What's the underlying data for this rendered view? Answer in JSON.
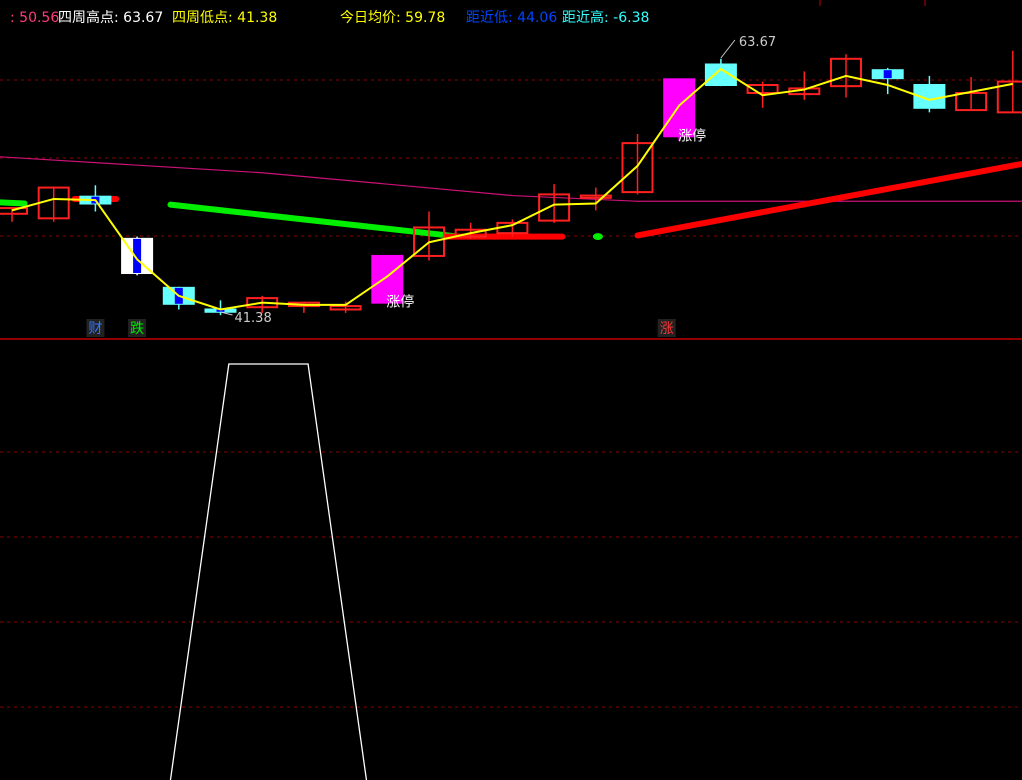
{
  "header": {
    "items": [
      {
        "label": "",
        "value": "50.56",
        "label_color": "#ff3b7b",
        "value_color": "#ff3b7b"
      },
      {
        "label": "四周高点",
        "value": "63.67",
        "label_color": "#ffffff",
        "value_color": "#ffffff"
      },
      {
        "label": "四周低点",
        "value": "41.38",
        "label_color": "#ffff00",
        "value_color": "#ffff00"
      },
      {
        "label": "今日均价",
        "value": "59.78",
        "label_color": "#ffff00",
        "value_color": "#ffff00"
      },
      {
        "label": "距近低",
        "value": "44.06",
        "label_color": "#0044ff",
        "value_color": "#0044ff"
      },
      {
        "label": "距近高",
        "value": "-6.38",
        "label_color": "#33ffff",
        "value_color": "#33ffff"
      }
    ]
  },
  "colors": {
    "background": "#000000",
    "up_candle": "#ff2020",
    "down_candle_body": "#66ffff",
    "down_candle_alt": "#0000ff",
    "limit_up": "#ff00ff",
    "avg_line": "#ffff00",
    "long_ma": "#cc1177",
    "trend_up": "#ff0000",
    "trend_down": "#00ee00",
    "grid": "#8b0000",
    "separator": "#c00000",
    "indicator": "#ffffff"
  },
  "chart_data": [
    {
      "type": "candlestick",
      "y_range": [
        40.5,
        66.0
      ],
      "candles": [
        {
          "o": 50.0,
          "h": 50.6,
          "l": 49.3,
          "c": 50.5,
          "style": "up"
        },
        {
          "o": 49.6,
          "h": 52.4,
          "l": 49.3,
          "c": 52.3,
          "style": "up"
        },
        {
          "o": 51.5,
          "h": 52.5,
          "l": 50.2,
          "c": 50.9,
          "style": "down"
        },
        {
          "o": 47.8,
          "h": 48.0,
          "l": 44.6,
          "c": 44.8,
          "style": "white-blue"
        },
        {
          "o": 43.5,
          "h": 43.6,
          "l": 41.6,
          "c": 42.1,
          "style": "down"
        },
        {
          "o": 41.6,
          "h": 42.4,
          "l": 41.1,
          "c": 41.4,
          "style": "down"
        },
        {
          "o": 41.8,
          "h": 42.8,
          "l": 41.3,
          "c": 42.6,
          "style": "up"
        },
        {
          "o": 41.9,
          "h": 42.3,
          "l": 41.3,
          "c": 42.2,
          "style": "up"
        },
        {
          "o": 41.6,
          "h": 42.3,
          "l": 41.3,
          "c": 41.9,
          "style": "up"
        },
        {
          "o": 42.2,
          "h": 46.3,
          "l": 42.2,
          "c": 46.3,
          "style": "limit",
          "label": "涨停"
        },
        {
          "o": 46.3,
          "h": 50.2,
          "l": 45.9,
          "c": 48.8,
          "style": "up"
        },
        {
          "o": 48.0,
          "h": 49.2,
          "l": 47.8,
          "c": 48.6,
          "style": "up"
        },
        {
          "o": 48.3,
          "h": 49.5,
          "l": 48.0,
          "c": 49.2,
          "style": "up"
        },
        {
          "o": 49.4,
          "h": 52.6,
          "l": 49.2,
          "c": 51.7,
          "style": "up"
        },
        {
          "o": 51.4,
          "h": 52.3,
          "l": 50.3,
          "c": 51.6,
          "style": "up"
        },
        {
          "o": 51.9,
          "h": 57.0,
          "l": 51.7,
          "c": 56.2,
          "style": "up"
        },
        {
          "o": 56.8,
          "h": 61.8,
          "l": 56.4,
          "c": 61.8,
          "style": "limit",
          "label": "涨停"
        },
        {
          "o": 63.1,
          "h": 63.6,
          "l": 61.2,
          "c": 61.3,
          "style": "down"
        },
        {
          "o": 60.6,
          "h": 61.6,
          "l": 59.3,
          "c": 61.3,
          "style": "up"
        },
        {
          "o": 60.5,
          "h": 62.5,
          "l": 60.0,
          "c": 61.0,
          "style": "up"
        },
        {
          "o": 61.2,
          "h": 64.0,
          "l": 60.2,
          "c": 63.6,
          "style": "up"
        },
        {
          "o": 62.6,
          "h": 62.8,
          "l": 60.5,
          "c": 61.9,
          "style": "down-blue"
        },
        {
          "o": 61.3,
          "h": 62.1,
          "l": 58.9,
          "c": 59.3,
          "style": "down"
        },
        {
          "o": 59.1,
          "h": 62.0,
          "l": 59.1,
          "c": 60.6,
          "style": "up"
        },
        {
          "o": 58.9,
          "h": 64.3,
          "l": 58.9,
          "c": 61.6,
          "style": "up"
        }
      ],
      "avg_line": [
        50.3,
        51.3,
        51.2,
        46.0,
        42.8,
        41.6,
        42.2,
        42.0,
        42.0,
        44.5,
        47.5,
        48.3,
        49.0,
        50.8,
        50.9,
        54.2,
        59.5,
        62.7,
        60.4,
        60.9,
        62.1,
        61.3,
        60.0,
        60.7,
        61.4
      ],
      "trend_band": [
        {
          "x_start": -0.3,
          "x_end": 0.3,
          "y_start": 51.0,
          "y_end": 50.9,
          "color": "green"
        },
        {
          "x_start": 1.5,
          "x_end": 2.5,
          "y_start": 51.3,
          "y_end": 51.3,
          "color": "red"
        },
        {
          "x_start": 3.8,
          "x_end": 10.7,
          "y_start": 50.8,
          "y_end": 48.0,
          "color": "green"
        },
        {
          "x_start": 10.4,
          "x_end": 13.2,
          "y_start": 48.0,
          "y_end": 48.0,
          "color": "red"
        },
        {
          "x_start": 14.0,
          "x_end": 14.1,
          "y_start": 48.0,
          "y_end": 48.0,
          "color": "green"
        },
        {
          "x_start": 15.0,
          "x_end": 24.4,
          "y_start": 48.1,
          "y_end": 54.5,
          "color": "red"
        }
      ],
      "long_ma": [
        [
          -0.3,
          55.0
        ],
        [
          6.0,
          53.6
        ],
        [
          12.0,
          51.6
        ],
        [
          15.0,
          51.1
        ],
        [
          24.4,
          51.1
        ]
      ],
      "annotations": {
        "high": "63.67",
        "low": "41.38"
      },
      "markers": [
        {
          "x": 2.0,
          "text": "财",
          "color": "#3377ff"
        },
        {
          "x": 3.0,
          "text": "跌",
          "color": "#00ee00"
        },
        {
          "x": 15.7,
          "text": "涨",
          "color": "#ff3333"
        }
      ]
    },
    {
      "type": "line",
      "y_range": [
        0,
        1
      ],
      "x": [
        3.8,
        5.2,
        7.1,
        8.5
      ],
      "values": [
        0,
        1,
        1,
        0
      ]
    }
  ]
}
